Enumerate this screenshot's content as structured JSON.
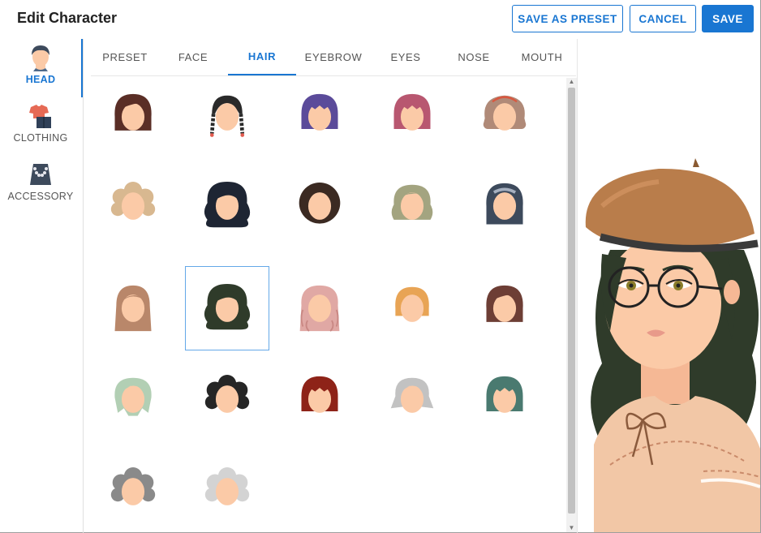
{
  "dialog": {
    "title": "Edit Character"
  },
  "actions": {
    "save_as_preset": "SAVE AS PRESET",
    "cancel": "CANCEL",
    "save": "SAVE"
  },
  "categories": [
    {
      "label": "HEAD",
      "icon": "head-icon",
      "active": true
    },
    {
      "label": "CLOTHING",
      "icon": "clothing-icon",
      "active": false
    },
    {
      "label": "ACCESSORY",
      "icon": "necklace-icon",
      "active": false
    }
  ],
  "tabs": [
    {
      "label": "PRESET",
      "active": false
    },
    {
      "label": "FACE",
      "active": false
    },
    {
      "label": "HAIR",
      "active": true
    },
    {
      "label": "EYEBROW",
      "active": false
    },
    {
      "label": "EYES",
      "active": false
    },
    {
      "label": "NOSE",
      "active": false
    },
    {
      "label": "MOUTH",
      "active": false
    }
  ],
  "hair_options": [
    {
      "style": "bob",
      "color": "#5a2e26"
    },
    {
      "style": "braids",
      "color": "#2a2a2a"
    },
    {
      "style": "bob-bangs",
      "color": "#5b4b9a"
    },
    {
      "style": "bob-bangs",
      "color": "#b85770"
    },
    {
      "style": "curly-headband",
      "color": "#b08a78"
    },
    {
      "style": "short-curly",
      "color": "#d8b890"
    },
    {
      "style": "long-wavy",
      "color": "#1e2533"
    },
    {
      "style": "big-curly",
      "color": "#3b2a22"
    },
    {
      "style": "wavy-medium",
      "color": "#a3a480"
    },
    {
      "style": "hijab",
      "color": "#3d4a5c"
    },
    {
      "style": "long-straight",
      "color": "#b9876a"
    },
    {
      "style": "long-wavy",
      "color": "#2f3b2a",
      "selected": true
    },
    {
      "style": "long-curly",
      "color": "#e0a8a4"
    },
    {
      "style": "short-bob",
      "color": "#e8a455"
    },
    {
      "style": "bob",
      "color": "#6d3e35"
    },
    {
      "style": "short-layered",
      "color": "#b2cfb4"
    },
    {
      "style": "short-curly",
      "color": "#262626"
    },
    {
      "style": "bob-bangs",
      "color": "#8e2318"
    },
    {
      "style": "short-flip",
      "color": "#c2c2c2"
    },
    {
      "style": "bob-bangs",
      "color": "#4a7a70"
    },
    {
      "style": "short-curly",
      "color": "#8a8a8a"
    },
    {
      "style": "short-curly",
      "color": "#d3d3d3"
    }
  ],
  "colors": {
    "accent": "#1976d2",
    "skin": "#fbcaa7",
    "beret": "#b97d4b",
    "preview_hair": "#2f3b2a",
    "blouse": "#f2c7a6"
  }
}
